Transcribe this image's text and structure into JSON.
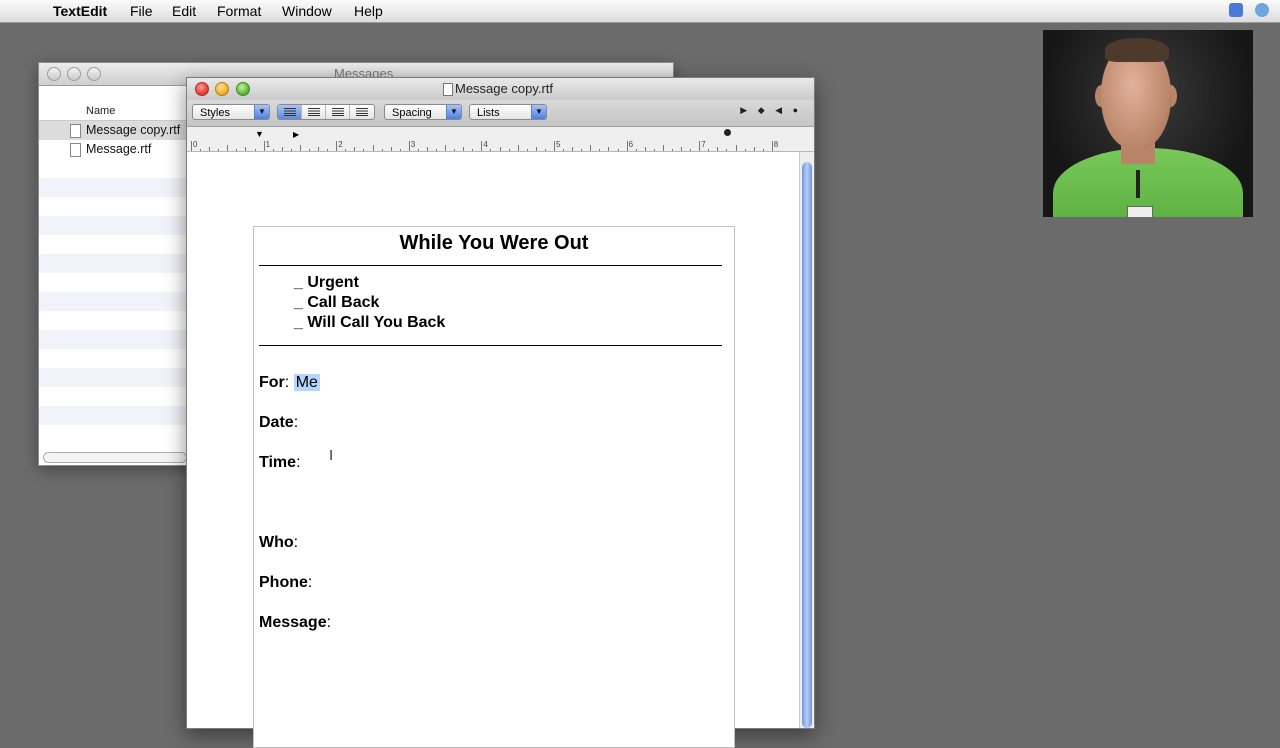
{
  "menubar": {
    "apple": "",
    "app_name": "TextEdit",
    "items": [
      "File",
      "Edit",
      "Format",
      "Window",
      "Help"
    ]
  },
  "finder_window": {
    "title": "Messages",
    "column_header": "Name",
    "files": [
      {
        "name": "Message copy.rtf",
        "selected": true
      },
      {
        "name": "Message.rtf",
        "selected": false
      }
    ]
  },
  "textedit_window": {
    "title": "Message copy.rtf",
    "toolbar": {
      "styles_label": "Styles",
      "spacing_label": "Spacing",
      "lists_label": "Lists"
    },
    "ruler_numbers": [
      "0",
      "1",
      "2",
      "3",
      "4",
      "5",
      "6",
      "7",
      "8"
    ]
  },
  "document": {
    "title": "While You Were Out",
    "checkboxes": [
      "_ Urgent",
      "_ Call Back",
      "_ Will Call You Back"
    ],
    "fields": [
      {
        "label": "For",
        "sep": ":",
        "value": "Me"
      },
      {
        "label": "Date",
        "sep": ":",
        "value": ""
      },
      {
        "label": "Time",
        "sep": ":",
        "value": ""
      },
      {
        "label": "Who",
        "sep": ":",
        "value": ""
      },
      {
        "label": "Phone",
        "sep": ":",
        "value": ""
      },
      {
        "label": "Message",
        "sep": ":",
        "value": ""
      }
    ]
  },
  "colors": {
    "desktop": "#6b6b6b",
    "selection": "#b5d4fe",
    "scroll_thumb": "#6f96e6",
    "shirt": "#6cc04d"
  }
}
